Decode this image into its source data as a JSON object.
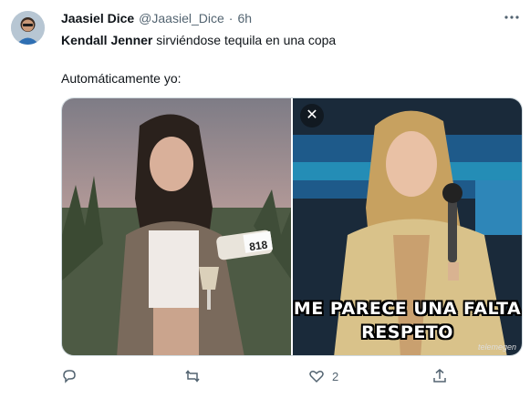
{
  "tweet": {
    "display_name": "Jaasiel Dice",
    "handle": "@Jaasiel_Dice",
    "separator": "·",
    "time": "6h",
    "text_bold": "Kendall Jenner",
    "text_rest": " sirviéndose tequila en una copa",
    "text_line2": "Automáticamente yo:"
  },
  "media": {
    "left_bottle_label": "818",
    "meme_line1": "ME PARECE UNA FALTA",
    "meme_line2": "RESPETO",
    "meme_watermark": "telemegen",
    "close_glyph": "✕"
  },
  "actions": {
    "reply_count": "",
    "retweet_count": "",
    "like_count": "2",
    "share_count": ""
  },
  "icons": [
    "avatar",
    "more-icon",
    "close-icon",
    "reply-icon",
    "retweet-icon",
    "like-icon",
    "share-icon"
  ],
  "colors": {
    "text": "#0f1419",
    "secondary": "#536471",
    "border": "#cfd9de"
  }
}
